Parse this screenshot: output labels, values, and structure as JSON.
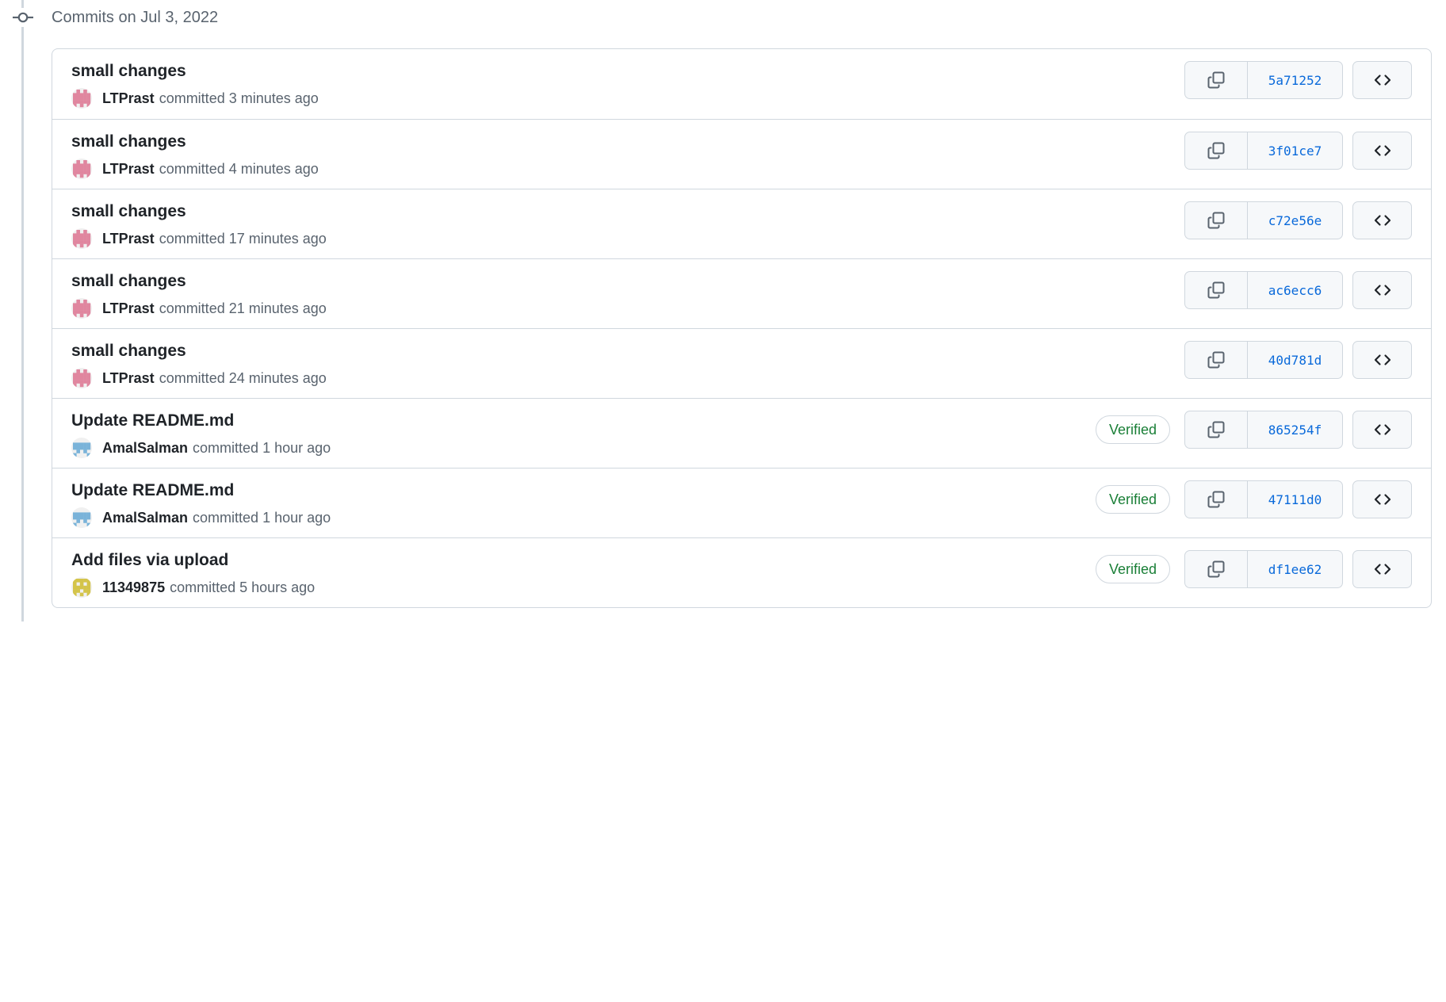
{
  "group": {
    "title": "Commits on Jul 3, 2022",
    "icon": "git-commit-icon"
  },
  "colors": {
    "verified": "#1a7f37",
    "sha_link": "#0969da",
    "border": "#d0d7de",
    "muted_text": "#59636e",
    "avatar_ltprast": "#e0869f",
    "avatar_amalsalman": "#7ab3d9",
    "avatar_11349875": "#d4c44a"
  },
  "commits": [
    {
      "message": "small changes",
      "author": "LTPrast",
      "verb": "committed",
      "time": "3 minutes ago",
      "verified": "",
      "sha": "5a71252",
      "avatar": "ltprast"
    },
    {
      "message": "small changes",
      "author": "LTPrast",
      "verb": "committed",
      "time": "4 minutes ago",
      "verified": "",
      "sha": "3f01ce7",
      "avatar": "ltprast"
    },
    {
      "message": "small changes",
      "author": "LTPrast",
      "verb": "committed",
      "time": "17 minutes ago",
      "verified": "",
      "sha": "c72e56e",
      "avatar": "ltprast"
    },
    {
      "message": "small changes",
      "author": "LTPrast",
      "verb": "committed",
      "time": "21 minutes ago",
      "verified": "",
      "sha": "ac6ecc6",
      "avatar": "ltprast"
    },
    {
      "message": "small changes",
      "author": "LTPrast",
      "verb": "committed",
      "time": "24 minutes ago",
      "verified": "",
      "sha": "40d781d",
      "avatar": "ltprast"
    },
    {
      "message": "Update README.md",
      "author": "AmalSalman",
      "verb": "committed",
      "time": "1 hour ago",
      "verified": "Verified",
      "sha": "865254f",
      "avatar": "amalsalman"
    },
    {
      "message": "Update README.md",
      "author": "AmalSalman",
      "verb": "committed",
      "time": "1 hour ago",
      "verified": "Verified",
      "sha": "47111d0",
      "avatar": "amalsalman"
    },
    {
      "message": "Add files via upload",
      "author": "11349875",
      "verb": "committed",
      "time": "5 hours ago",
      "verified": "Verified",
      "sha": "df1ee62",
      "avatar": "11349875"
    }
  ]
}
